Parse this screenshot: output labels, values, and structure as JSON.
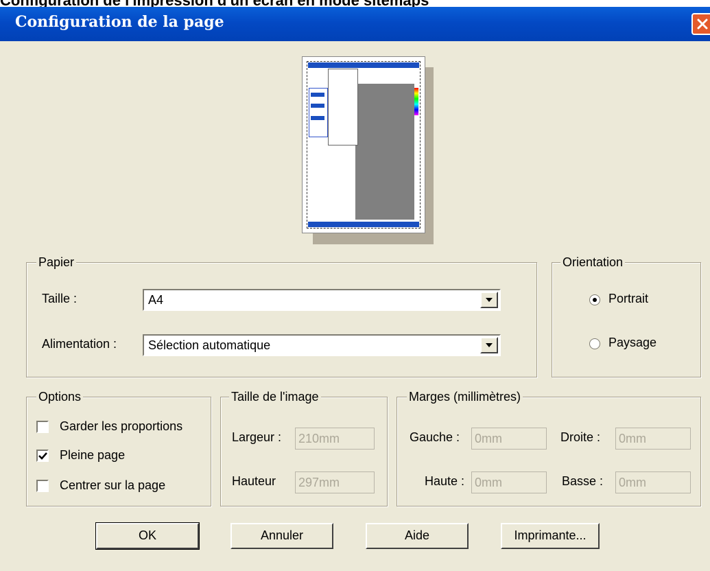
{
  "behind_text": "Configuration de l'impression d'un écran en mode sitemaps",
  "window": {
    "title": "Configuration de la page"
  },
  "paper": {
    "legend": "Papier",
    "size_label": "Taille :",
    "size_value": "A4",
    "source_label": "Alimentation :",
    "source_value": "Sélection automatique"
  },
  "orientation": {
    "legend": "Orientation",
    "options": [
      {
        "label": "Portrait",
        "selected": true
      },
      {
        "label": "Paysage",
        "selected": false
      }
    ]
  },
  "options": {
    "legend": "Options",
    "items": [
      {
        "label": "Garder les proportions",
        "checked": false
      },
      {
        "label": "Pleine page",
        "checked": true
      },
      {
        "label": "Centrer sur la page",
        "checked": false
      }
    ]
  },
  "image_size": {
    "legend": "Taille de l'image",
    "width_label": "Largeur :",
    "width_value": "210mm",
    "height_label": "Hauteur",
    "height_value": "297mm"
  },
  "margins": {
    "legend": "Marges (millimètres)",
    "left_label": "Gauche :",
    "left_value": "0mm",
    "right_label": "Droite :",
    "right_value": "0mm",
    "top_label": "Haute :",
    "top_value": "0mm",
    "bottom_label": "Basse :",
    "bottom_value": "0mm"
  },
  "buttons": {
    "ok": "OK",
    "cancel": "Annuler",
    "help": "Aide",
    "printer": "Imprimante..."
  },
  "icons": {
    "close": "close-icon",
    "dropdown": "chevron-down-icon",
    "check": "checkmark-icon"
  },
  "colors": {
    "titlebar": "#0349c4",
    "dialog_bg": "#ece9d8",
    "close_button": "#e45a2b",
    "preview_gray": "#808080"
  }
}
